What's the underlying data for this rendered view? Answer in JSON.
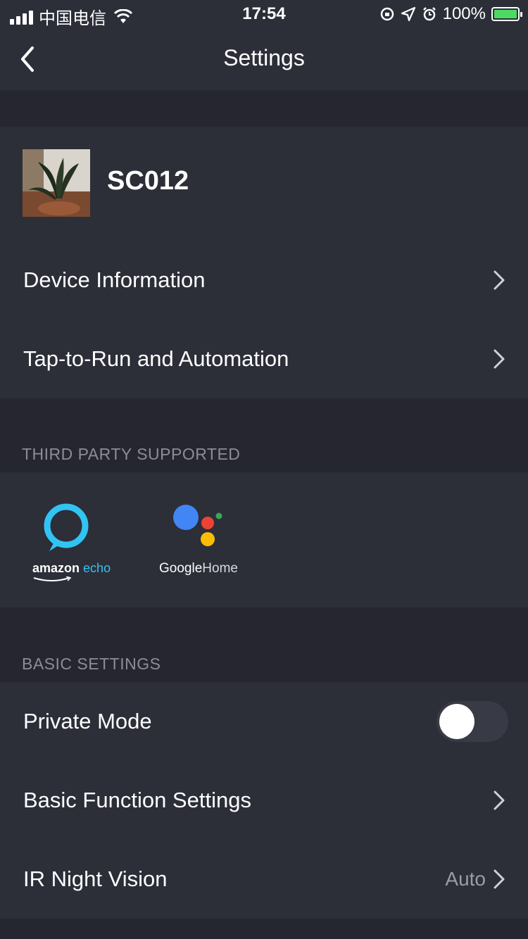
{
  "status_bar": {
    "carrier": "中国电信",
    "time": "17:54",
    "battery_percent": "100%"
  },
  "nav": {
    "title": "Settings"
  },
  "device": {
    "name": "SC012"
  },
  "device_rows": [
    {
      "label": "Device Information"
    },
    {
      "label": "Tap-to-Run and Automation"
    }
  ],
  "third_party": {
    "header": "THIRD PARTY SUPPORTED",
    "amazon": {
      "word1": "amazon",
      "word2": "echo"
    },
    "google": {
      "word1": "Google",
      "word2": "Home"
    }
  },
  "basic": {
    "header": "BASIC SETTINGS",
    "private_mode": {
      "label": "Private Mode",
      "enabled": false
    },
    "basic_function": {
      "label": "Basic Function Settings"
    },
    "ir_night_vision": {
      "label": "IR Night Vision",
      "value": "Auto"
    }
  },
  "colors": {
    "background": "#25262f",
    "card": "#2c2e38",
    "muted_text": "#8b8d97",
    "alexa_blue": "#31c4f3",
    "google_blue": "#4285f4",
    "google_red": "#ea4335",
    "google_yellow": "#fbbc05",
    "google_green": "#34a853"
  }
}
